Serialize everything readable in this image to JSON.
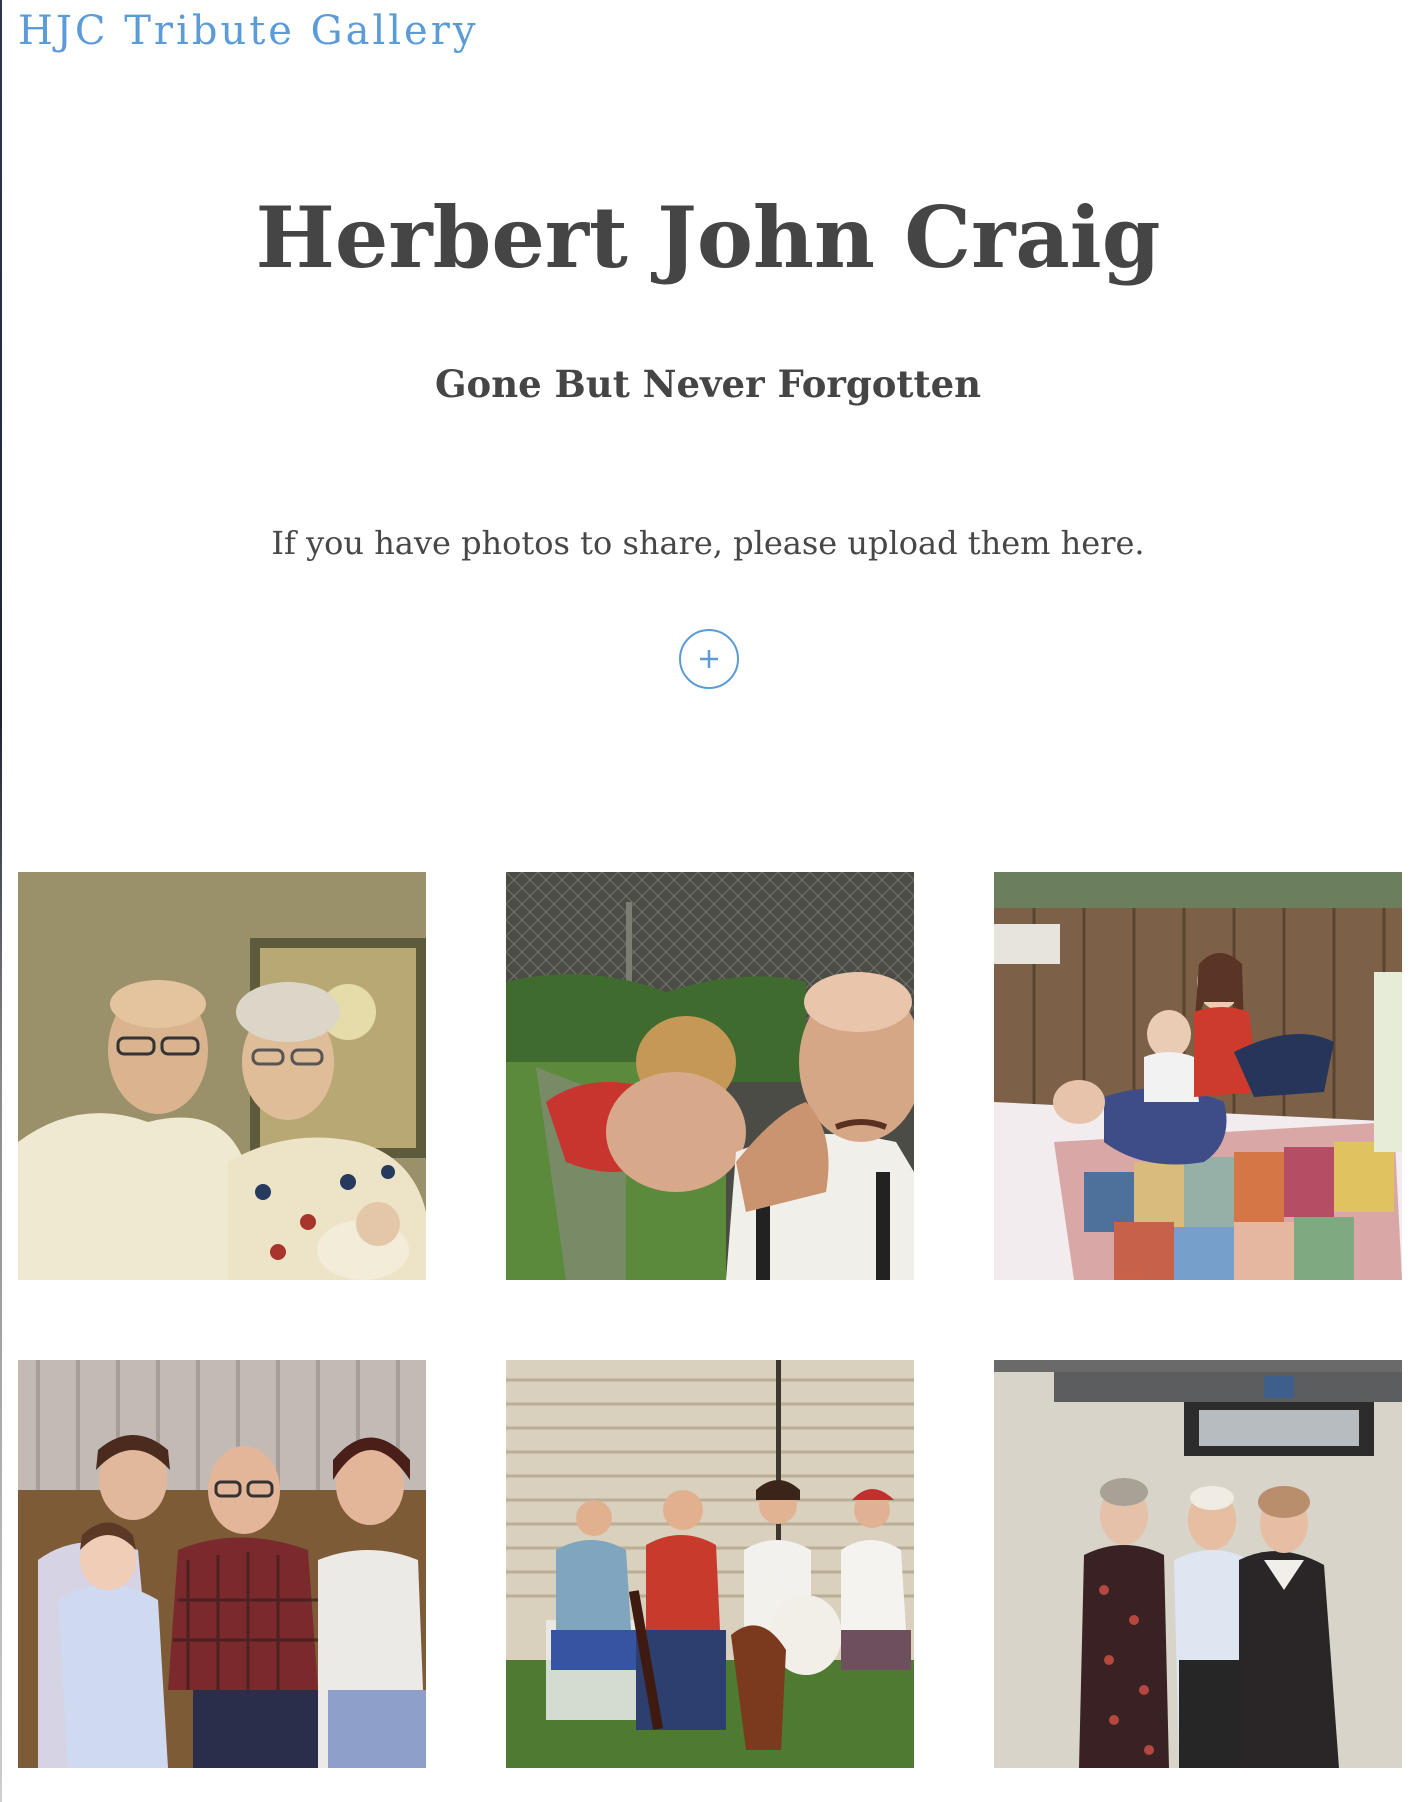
{
  "site": {
    "title": "HJC Tribute Gallery"
  },
  "header": {
    "title": "Herbert John Craig",
    "subtitle": "Gone But Never Forgotten"
  },
  "upload": {
    "prompt": "If you have photos to share, please upload them here.",
    "button_icon": "plus-icon",
    "accent_color": "#5b9bd8"
  },
  "gallery": {
    "photos": [
      {
        "id": "photo-1"
      },
      {
        "id": "photo-2"
      },
      {
        "id": "photo-3"
      },
      {
        "id": "photo-4"
      },
      {
        "id": "photo-5"
      },
      {
        "id": "photo-6"
      }
    ]
  }
}
